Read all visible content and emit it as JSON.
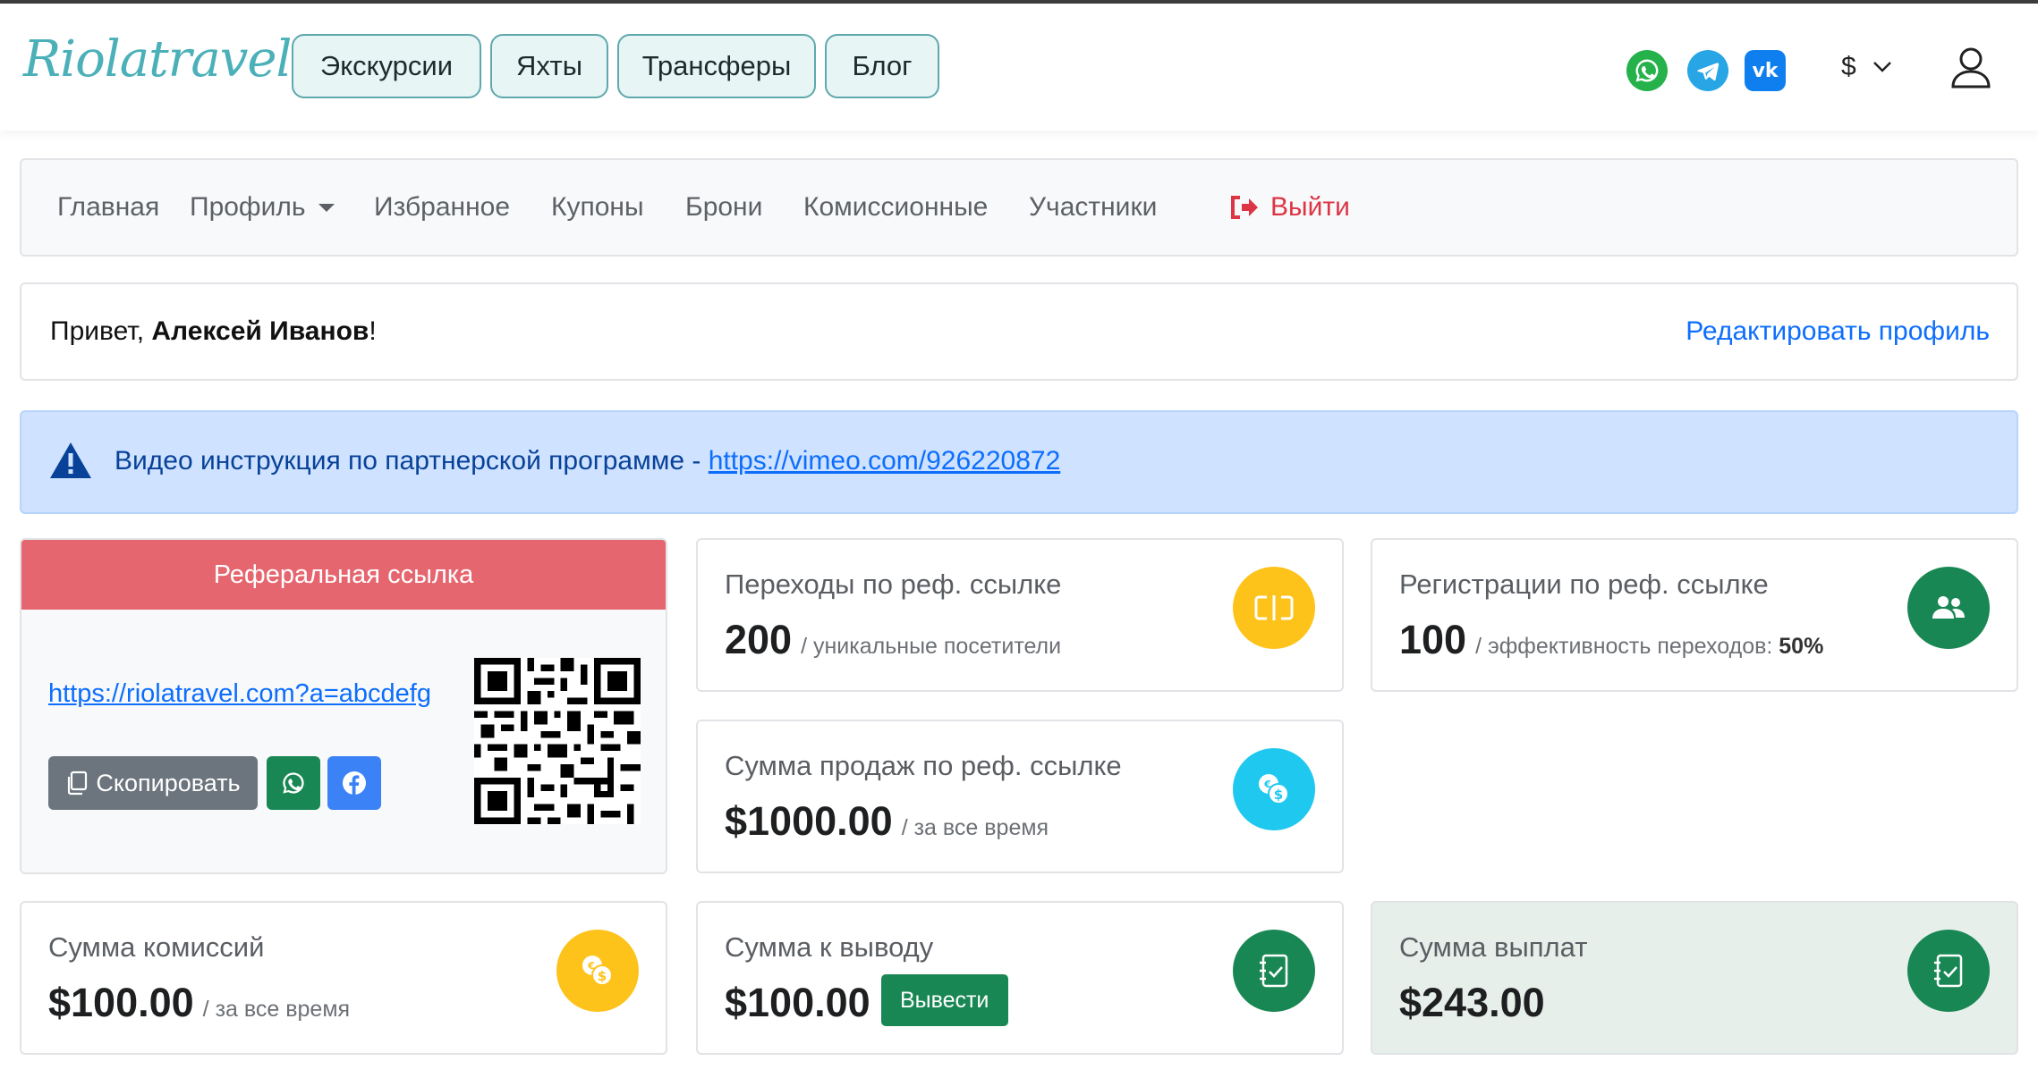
{
  "header": {
    "logo": "Riolatravel",
    "nav": [
      "Экскурсии",
      "Яхты",
      "Трансферы",
      "Блог"
    ],
    "currency": "$"
  },
  "subnav": {
    "items": [
      "Главная",
      "Профиль",
      "Избранное",
      "Купоны",
      "Брони",
      "Комиссионные",
      "Участники"
    ],
    "logout": "Выйти"
  },
  "greeting": {
    "prefix": "Привет, ",
    "name": "Алексей Иванов",
    "suffix": "!",
    "edit_link": "Редактировать профиль"
  },
  "alert": {
    "text": "Видео инструкция по партнерской программе - ",
    "link": "https://vimeo.com/926220872"
  },
  "referral": {
    "title": "Реферальная ссылка",
    "link": "https://riolatravel.com?a=abcdefg",
    "copy_label": "Скопировать"
  },
  "cards": {
    "clicks": {
      "title": "Переходы по реф. ссылке",
      "value": "200",
      "sub": "/ уникальные посетители",
      "color": "#fdc31b"
    },
    "registrations": {
      "title": "Регистрации по реф. ссылке",
      "value": "100",
      "sub": "/ эффективность переходов:",
      "sub_bold": "50%",
      "color": "#198754"
    },
    "sales": {
      "title": "Сумма продаж по реф. ссылке",
      "value": "$1000.00",
      "sub": "/ за все время",
      "color": "#1fc8ee"
    },
    "commissions": {
      "title": "Сумма комиссий",
      "value": "$100.00",
      "sub": "/ за все время",
      "color": "#fdc31b"
    },
    "withdrawable": {
      "title": "Сумма к выводу",
      "value": "$100.00",
      "button": "Вывести",
      "color": "#198754"
    },
    "payouts": {
      "title": "Сумма выплат",
      "value": "$243.00",
      "color": "#198754",
      "bg": "#e7efea"
    }
  }
}
